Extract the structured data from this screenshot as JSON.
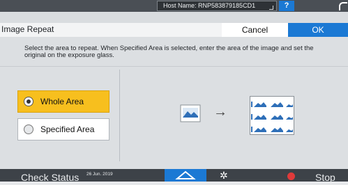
{
  "system_bar": {
    "host_name": "Host Name: RNP583879185CD1",
    "help_label": "?"
  },
  "title_bar": {
    "title": "Image Repeat",
    "cancel_label": "Cancel",
    "ok_label": "OK"
  },
  "instructions": "Select the area to repeat. When Specified Area is selected, enter the area of the image and set the original on the exposure glass.",
  "options": [
    {
      "label": "Whole Area",
      "selected": true
    },
    {
      "label": "Specified Area",
      "selected": false
    }
  ],
  "illustration": {
    "arrow": "→"
  },
  "bottom_bar": {
    "check_status_label": "Check Status",
    "date_line1": "26 Jun. 2019",
    "stop_label": "Stop"
  },
  "colors": {
    "accent_blue": "#1b79d4",
    "selected_yellow": "#f7bf1e",
    "stop_red": "#e03a3a"
  }
}
